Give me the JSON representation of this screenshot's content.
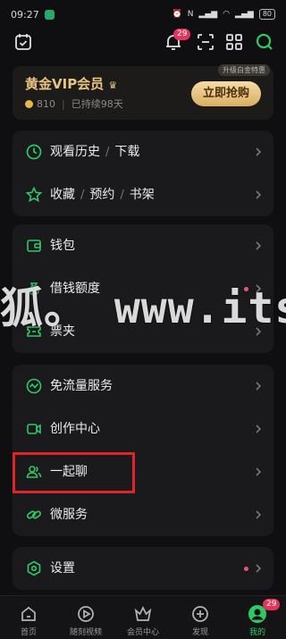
{
  "status_bar": {
    "time": "09:27",
    "battery": "80",
    "icons": [
      "app-icon",
      "alarm-icon",
      "nfc-icon",
      "signal-icon",
      "wifi-icon",
      "battery-icon"
    ]
  },
  "top_bar": {
    "notification_count": "29",
    "icons": [
      "calendar-check-icon",
      "bell-icon",
      "scan-icon",
      "qr-code-icon",
      "search-icon"
    ]
  },
  "vip": {
    "title": "黄金VIP会员",
    "points": "810",
    "duration": "已持续98天",
    "upgrade_tag": "升级白金特惠",
    "buy_button": "立即抢购"
  },
  "groups": [
    {
      "items": [
        {
          "name": "history",
          "icon": "clock-icon",
          "parts": [
            "观看历史",
            "下载"
          ]
        },
        {
          "name": "favorites",
          "icon": "star-icon",
          "parts": [
            "收藏",
            "预约",
            "书架"
          ]
        }
      ]
    },
    {
      "items": [
        {
          "name": "wallet",
          "icon": "wallet-icon",
          "parts": [
            "钱包"
          ]
        },
        {
          "name": "borrow",
          "icon": "money-bag-icon",
          "parts": [
            "借钱额度"
          ],
          "dot": true
        },
        {
          "name": "tickets",
          "icon": "ticket-icon",
          "parts": [
            "票夹"
          ]
        }
      ]
    },
    {
      "items": [
        {
          "name": "free-data",
          "icon": "wave-circle-icon",
          "parts": [
            "免流量服务"
          ]
        },
        {
          "name": "creator",
          "icon": "camera-icon",
          "parts": [
            "创作中心"
          ]
        },
        {
          "name": "chat-together",
          "icon": "users-icon",
          "parts": [
            "一起聊"
          ]
        },
        {
          "name": "micro-service",
          "icon": "link-icon",
          "parts": [
            "微服务"
          ]
        }
      ]
    },
    {
      "items": [
        {
          "name": "settings",
          "icon": "settings-icon",
          "parts": [
            "设置"
          ],
          "dot": true
        }
      ]
    }
  ],
  "watermark": "狐。 www.itsec",
  "bottom_nav": [
    {
      "label": "首页",
      "icon": "home-icon"
    },
    {
      "label": "随刻视频",
      "icon": "play-circle-icon"
    },
    {
      "label": "会员中心",
      "icon": "crown-icon"
    },
    {
      "label": "发现",
      "icon": "plus-circle-icon"
    },
    {
      "label": "我的",
      "icon": "profile-icon",
      "badge": "29",
      "active": true
    }
  ],
  "colors": {
    "accent_green": "#2fc867",
    "gold": "#e8c482",
    "badge_red": "#e5335c",
    "highlight_red": "#e0242a"
  }
}
